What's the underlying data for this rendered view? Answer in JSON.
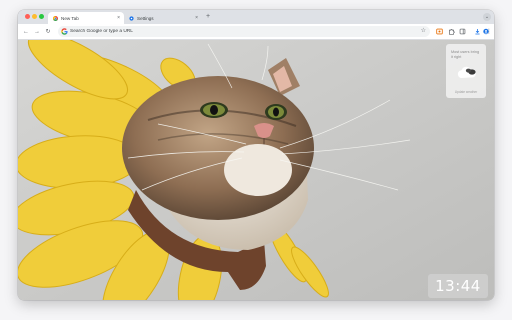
{
  "window": {
    "tabs": [
      {
        "label": "New Tab",
        "active": true,
        "favicon": "chrome-icon"
      },
      {
        "label": "Settings",
        "active": false,
        "favicon": "settings-gear-icon"
      }
    ],
    "new_tab_symbol": "+",
    "close_symbol": "×",
    "tab_search_symbol": "⌄"
  },
  "toolbar": {
    "back_symbol": "←",
    "forward_symbol": "→",
    "reload_symbol": "↻",
    "omnibox_placeholder": "Search Google or type a URL",
    "bookmark_symbol": "☆",
    "menu_symbol": "⋮",
    "extensions": [
      "photo-extension-icon",
      "puzzle-extension-icon",
      "sidebar-icon",
      "download-icon",
      "profile-icon"
    ]
  },
  "newtab": {
    "background_image": "cat-in-sunflower-costume",
    "widget": {
      "title": "Most users bring it right",
      "footer": "Update weather"
    },
    "clock": "13:44"
  },
  "colors": {
    "accent": "#1a73e8",
    "tabstrip": "#dee1e6",
    "omnibox": "#f1f3f4",
    "petal": "#f0cd3a",
    "wall": "#c9c9c7"
  }
}
